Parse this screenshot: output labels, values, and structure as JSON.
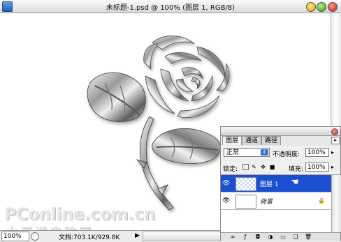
{
  "window": {
    "title": "未标题-1.psd @ 100% (图层 1, RGB/8)"
  },
  "watermark": {
    "text": "PConline.com.cn",
    "text_cn": "太平洋电脑网"
  },
  "status": {
    "zoom": "100%",
    "doc_info": "文档:703.1K/929.8K",
    "arrow": "▶"
  },
  "layers_panel": {
    "tabs": [
      {
        "label": "图层",
        "active": true
      },
      {
        "label": "通道",
        "active": false
      },
      {
        "label": "路径",
        "active": false
      }
    ],
    "blend_mode": "正常",
    "opacity_label": "不透明度:",
    "opacity": "100%",
    "lock_label": "锁定:",
    "fill_label": "填充:",
    "fill": "100%",
    "layers": [
      {
        "name": "图层 1",
        "selected": true,
        "thumb": "checker"
      },
      {
        "name": "背景",
        "selected": false,
        "thumb": "white",
        "locked": true
      }
    ]
  },
  "colors": {
    "selection": "#1a4fcf",
    "panel_bg": "#e8e8e8"
  }
}
